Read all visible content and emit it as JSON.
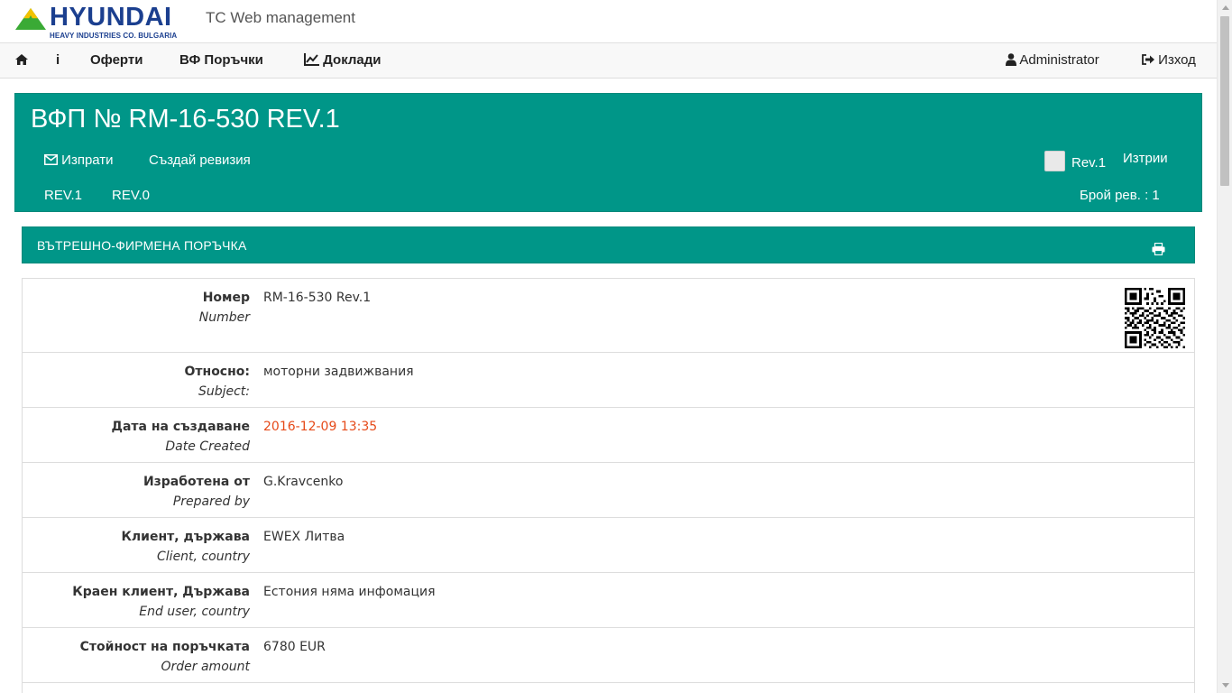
{
  "header": {
    "brand": "HYUNDAI",
    "brand_sub": "HEAVY INDUSTRIES CO. BULGARIA",
    "app_title": "TC Web management",
    "colors": {
      "brand_blue": "#1b3f8f",
      "logo_green": "#3aaa35",
      "logo_yellow": "#f2c200"
    }
  },
  "nav": {
    "home_icon": "home-icon",
    "info_label": "i",
    "offers": "Оферти",
    "orders": "ВФ Поръчки",
    "reports": "Доклади",
    "reports_icon": "line-chart-icon",
    "user": "Administrator",
    "user_icon": "user-icon",
    "logout": "Изход",
    "logout_icon": "sign-out-icon"
  },
  "title_panel": {
    "title": "ВФП № RM-16-530 REV.1",
    "send_label": "Изпрати",
    "send_icon": "envelope-icon",
    "create_revision_label": "Създай ревизия",
    "revision_checkbox_label": "Rev.1",
    "delete_label": "Изтрии",
    "revision_tabs": [
      "REV.1",
      "REV.0"
    ],
    "revision_count_label": "Брой рев. : 1",
    "accent_color": "#009688"
  },
  "section": {
    "title": "ВЪТРЕШНО-ФИРМЕНА ПОРЪЧКА",
    "print_icon": "print-icon"
  },
  "details": {
    "rows": [
      {
        "label_bg": "Номер",
        "label_en": "Number",
        "value": "RM-16-530 Rev.1"
      },
      {
        "label_bg": "Относно:",
        "label_en": "Subject:",
        "value": "моторни задвижвания"
      },
      {
        "label_bg": "Дата на създаване",
        "label_en": "Date Created",
        "value": "2016-12-09 13:35"
      },
      {
        "label_bg": "Изработена от",
        "label_en": "Prepared by",
        "value": "G.Kravcenko"
      },
      {
        "label_bg": "Клиент, държава",
        "label_en": "Client, country",
        "value": "EWEX Литва"
      },
      {
        "label_bg": "Краен клиент, Държава",
        "label_en": "End user, country",
        "value": "Естония няма инфомация"
      },
      {
        "label_bg": "Стойност на поръчката",
        "label_en": "Order amount",
        "value": "6780 EUR"
      }
    ],
    "date_color": "#e64a19",
    "qr_icon": "qr-code-icon"
  }
}
